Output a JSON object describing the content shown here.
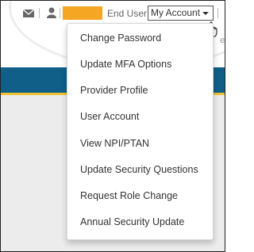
{
  "header": {
    "role_label": "End User",
    "account_button_label": "My Account",
    "right_edge_fragment": "ew",
    "name_block_color": "#f5a623",
    "icons": [
      "mail-icon",
      "person-icon",
      "chevron-down-icon",
      "hand-cursor-icon"
    ]
  },
  "banner": {
    "color": "#0f5f88",
    "accent_color": "#f1c232"
  },
  "account_menu": {
    "items": [
      {
        "label": "Change Password"
      },
      {
        "label": "Update MFA Options"
      },
      {
        "label": "Provider Profile"
      },
      {
        "label": "User Account"
      },
      {
        "label": "View NPI/PTAN"
      },
      {
        "label": "Update Security Questions"
      },
      {
        "label": "Request Role Change"
      },
      {
        "label": "Annual Security Update"
      }
    ]
  }
}
